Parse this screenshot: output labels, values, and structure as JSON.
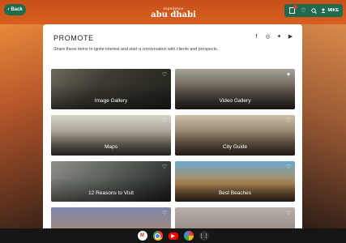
{
  "header": {
    "back_label": "Back",
    "logo_small": "experience",
    "logo_big": "abu dhabi",
    "user_label": "MIKE"
  },
  "panel": {
    "title": "PROMOTE",
    "description": "Share these items to ignite interest and start a conversation with clients and prospects.",
    "social_icons": [
      "facebook-icon",
      "instagram-icon",
      "twitter-icon",
      "youtube-icon"
    ]
  },
  "tiles": [
    {
      "label": "Image Gallery"
    },
    {
      "label": "Video Gallery"
    },
    {
      "label": "Maps"
    },
    {
      "label": "City Guide"
    },
    {
      "label": "12 Reasons to Visit"
    },
    {
      "label": "Best Beaches"
    },
    {
      "label": ""
    },
    {
      "label": ""
    }
  ],
  "taskbar": {
    "apps": [
      "gmail-icon",
      "chrome-icon",
      "youtube-icon",
      "photos-icon",
      "launcher-icon"
    ]
  },
  "colors": {
    "brand_green": "#1f6b4b",
    "notification_red": "#e23a3a"
  }
}
